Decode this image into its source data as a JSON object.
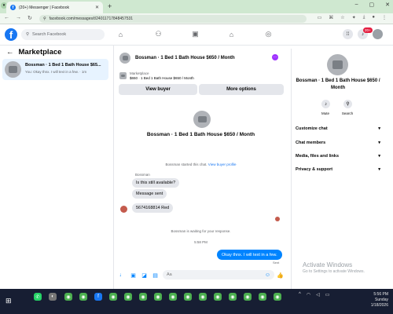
{
  "browser": {
    "tab_title": "(20+) Messenger | Facebook",
    "tab_icon": "facebook-icon",
    "url": "facebook.com/messages/t/24011717848457531",
    "new_tab_label": "+"
  },
  "header": {
    "search_placeholder": "Search Facebook",
    "notification_badge": "20+"
  },
  "sidebar": {
    "title": "Marketplace",
    "conversation": {
      "name": "Bossman · 1 Bed 1 Bath House $65...",
      "preview": "You: Okay thnx. I will text in a few. · 1m"
    }
  },
  "chat": {
    "title": "Bossman · 1 Bed 1 Bath House $650 / Month",
    "listing_label": "Marketplace",
    "listing_text": "$650 · 1 Bed 1 Bath House $650 / Month",
    "view_buyer_label": "View buyer",
    "more_options_label": "More options",
    "big_title": "Bossman · 1 Bed 1 Bath House $650 / Month",
    "started_text": "Bossman started this chat.",
    "view_profile_link": "View buyer profile",
    "sender_name": "Bossman",
    "messages_in": [
      "Is this still available?",
      "Message sent",
      "5674168814 Red"
    ],
    "waiting_text": "Bossman is waiting for your response.",
    "time": "5:58 PM",
    "message_out": "Okay thnx. I will text in a few.",
    "sent_label": "Sent",
    "input_placeholder": "Aa"
  },
  "details": {
    "title": "Bossman · 1 Bed 1 Bath House $650 / Month",
    "mute_label": "Mute",
    "search_label": "Search",
    "rows": [
      "Customize chat",
      "Chat members",
      "Media, files and links",
      "Privacy & support"
    ]
  },
  "watermark": {
    "line1": "Activate Windows",
    "line2": "Go to Settings to activate Windows."
  },
  "taskbar": {
    "time": "5:56 PM",
    "day": "Sunday",
    "date": "1/18/2026"
  },
  "colors": {
    "brand": "#1877f2",
    "outgoing_bubble": "#0084ff",
    "incoming_bubble": "#e4e6eb",
    "selected_row": "#e7f3ff",
    "taskbar": "#171e33"
  }
}
